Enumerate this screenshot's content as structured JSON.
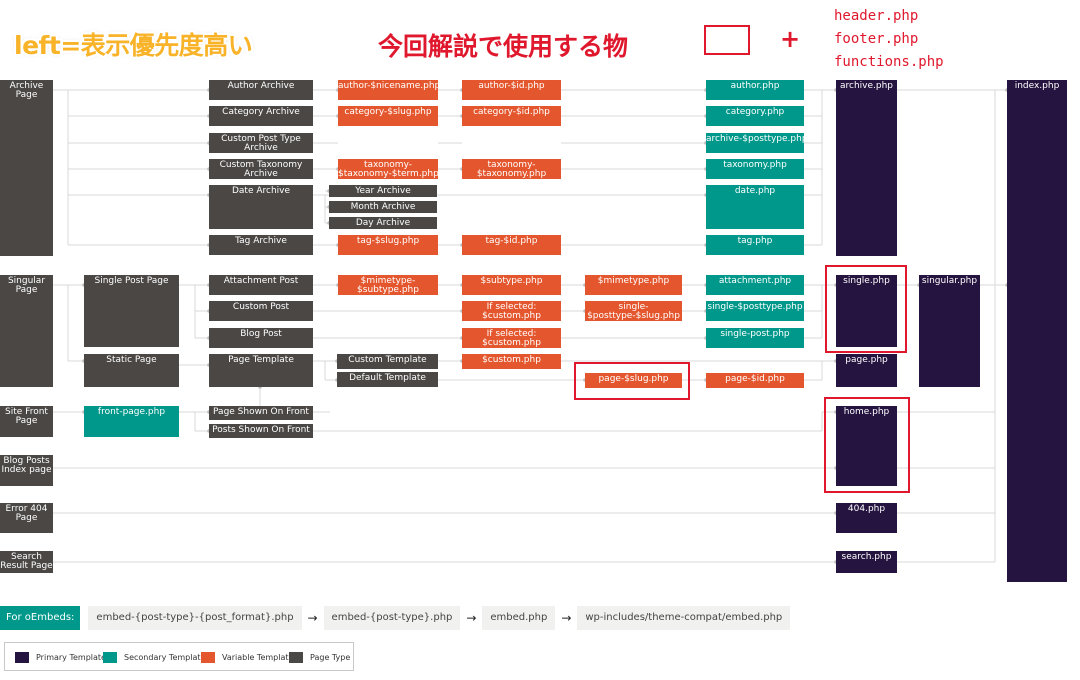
{
  "annotations": {
    "left_priority": "left=表示優先度高い",
    "used_in_tutorial": "今回解説で使用する物",
    "plus": "+",
    "extra_files": [
      "header.php",
      "footer.php",
      "functions.php"
    ]
  },
  "colors": {
    "page_type": "#4a4745",
    "primary": "#261440",
    "secondary": "#00988a",
    "variable": "#e4572e",
    "highlight": "#e0182d",
    "wire": "#dcdcdc"
  },
  "nodes": {
    "archive_page": "Archive Page",
    "singular_page": "Singular\nPage",
    "site_front_page": "Site Front\nPage",
    "blog_posts_index": "Blog Posts\nIndex page",
    "error_404": "Error 404\nPage",
    "search_result": "Search\nResult Page",
    "author_archive": "Author Archive",
    "category_archive": "Category Archive",
    "cpt_archive": "Custom Post Type\nArchive",
    "ctax_archive": "Custom Taxonomy\nArchive",
    "date_archive": "Date Archive",
    "tag_archive": "Tag Archive",
    "year_archive": "Year Archive",
    "month_archive": "Month Archive",
    "day_archive": "Day Archive",
    "author_nicename": "author-$nicename.php",
    "category_slug": "category-$slug.php",
    "taxonomy_term": "taxonomy-\n$taxonomy-$term.php",
    "tag_slug": "tag-$slug.php",
    "author_id": "author-$id.php",
    "category_id": "category-$id.php",
    "taxonomy_tax": "taxonomy-\n$taxonomy.php",
    "tag_id": "tag-$id.php",
    "author_php": "author.php",
    "category_php": "category.php",
    "archive_posttype": "archive-$posttype.php",
    "taxonomy_php": "taxonomy.php",
    "date_php": "date.php",
    "tag_php": "tag.php",
    "archive_php": "archive.php",
    "index_php": "index.php",
    "single_post_page": "Single Post Page",
    "static_page": "Static Page",
    "attachment_post": "Attachment Post",
    "custom_post": "Custom Post",
    "blog_post": "Blog Post",
    "page_template": "Page Template",
    "custom_template": "Custom Template",
    "default_template": "Default Template",
    "mimetype_subtype": "$mimetype-\n$subtype.php",
    "subtype_php": "$subtype.php",
    "mimetype_php": "$mimetype.php",
    "if_selected_1": "If selected:\n$custom.php",
    "if_selected_2": "If selected:\n$custom.php",
    "custom_php": "$custom.php",
    "single_posttype_slug": "single-\n$posttype-$slug.php",
    "page_slug": "page-$slug.php",
    "attachment_php": "attachment.php",
    "single_posttype": "single-$posttype.php",
    "single_post_php": "single-post.php",
    "page_id": "page-$id.php",
    "single_php": "single.php",
    "page_php": "page.php",
    "singular_php": "singular.php",
    "front_page_php": "front-page.php",
    "page_shown_on_front": "Page Shown On Front",
    "posts_shown_on_front": "Posts Shown On Front",
    "home_php": "home.php",
    "php_404": "404.php",
    "search_php": "search.php"
  },
  "embeds": {
    "label": "For oEmbeds:",
    "items": [
      "embed-{post-type}-{post_format}.php",
      "embed-{post-type}.php",
      "embed.php",
      "wp-includes/theme-compat/embed.php"
    ],
    "arrow": "→"
  },
  "legend": [
    {
      "label": "Primary Template",
      "color": "#261440"
    },
    {
      "label": "Secondary Template",
      "color": "#00988a"
    },
    {
      "label": "Variable Template",
      "color": "#e4572e"
    },
    {
      "label": "Page Type",
      "color": "#4a4745"
    }
  ]
}
